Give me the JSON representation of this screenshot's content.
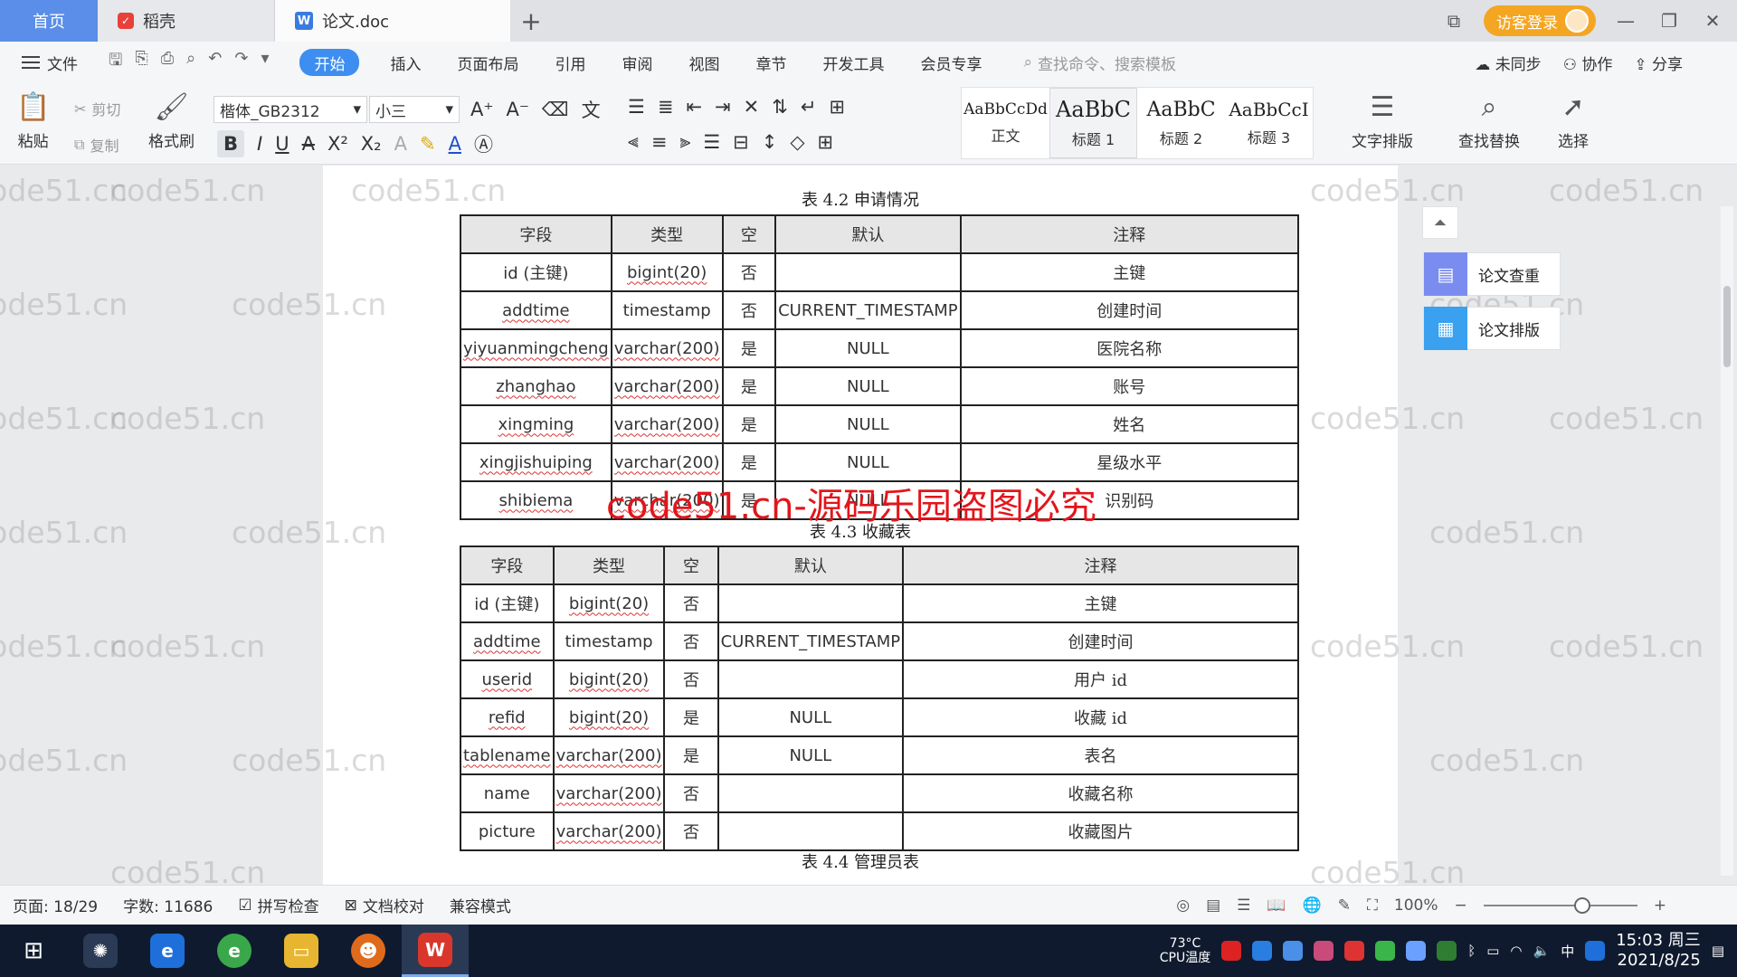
{
  "tabs": {
    "home": "首页",
    "daoke": "稻壳",
    "doc": "论文.doc",
    "add": "+",
    "visitor_login": "访客登录"
  },
  "menu": {
    "file": "文件",
    "items": [
      "开始",
      "插入",
      "页面布局",
      "引用",
      "审阅",
      "视图",
      "章节",
      "开发工具",
      "会员专享"
    ],
    "active_index": 0,
    "search_placeholder": "查找命令、搜索模板",
    "right": [
      "未同步",
      "协作",
      "分享"
    ]
  },
  "ribbon": {
    "paste": "粘贴",
    "cut": "剪切",
    "copy": "复制",
    "format_painter": "格式刷",
    "font_name": "楷体_GB2312",
    "font_size": "小三",
    "styles": [
      {
        "sample": "AaBbCcDd",
        "caption": "正文"
      },
      {
        "sample": "AaBbC",
        "caption": "标题 1"
      },
      {
        "sample": "AaBbC",
        "caption": "标题 2"
      },
      {
        "sample": "AaBbCcI",
        "caption": "标题 3"
      }
    ],
    "text_layout": "文字排版",
    "find_replace": "查找替换",
    "select": "选择"
  },
  "document": {
    "top_caption": "表 4.2  申请情况",
    "table1": {
      "headers": [
        "字段",
        "类型",
        "空",
        "默认",
        "注释"
      ],
      "rows": [
        [
          "id (主键)",
          "bigint(20)",
          "否",
          "",
          "主键"
        ],
        [
          "addtime",
          "timestamp",
          "否",
          "CURRENT_TIMESTAMP",
          "创建时间"
        ],
        [
          "yiyuanmingcheng",
          "varchar(200)",
          "是",
          "NULL",
          "医院名称"
        ],
        [
          "zhanghao",
          "varchar(200)",
          "是",
          "NULL",
          "账号"
        ],
        [
          "xingming",
          "varchar(200)",
          "是",
          "NULL",
          "姓名"
        ],
        [
          "xingjishuiping",
          "varchar(200)",
          "是",
          "NULL",
          "星级水平"
        ],
        [
          "shibiema",
          "varchar(200)",
          "是",
          "NULL",
          "识别码"
        ]
      ]
    },
    "caption2": "表 4.3  收藏表",
    "table2": {
      "headers": [
        "字段",
        "类型",
        "空",
        "默认",
        "注释"
      ],
      "rows": [
        [
          "id (主键)",
          "bigint(20)",
          "否",
          "",
          "主键"
        ],
        [
          "addtime",
          "timestamp",
          "否",
          "CURRENT_TIMESTAMP",
          "创建时间"
        ],
        [
          "userid",
          "bigint(20)",
          "否",
          "",
          "用户 id"
        ],
        [
          "refid",
          "bigint(20)",
          "是",
          "NULL",
          "收藏 id"
        ],
        [
          "tablename",
          "varchar(200)",
          "是",
          "NULL",
          "表名"
        ],
        [
          "name",
          "varchar(200)",
          "否",
          "",
          "收藏名称"
        ],
        [
          "picture",
          "varchar(200)",
          "否",
          "",
          "收藏图片"
        ]
      ]
    },
    "caption3": "表 4.4  管理员表",
    "watermark": "code51.cn",
    "red_stamp": "code51.cn-源码乐园盗图必究"
  },
  "side_panel": {
    "check": "论文查重",
    "layout": "论文排版"
  },
  "status": {
    "page": "页面: 18/29",
    "words": "字数: 11686",
    "spell": "拼写检查",
    "proof": "文档校对",
    "compat": "兼容模式",
    "zoom": "100%"
  },
  "taskbar": {
    "temp": "73°C",
    "cpu": "CPU温度",
    "time": "15:03 周三",
    "date": "2021/8/25",
    "ime": "中"
  },
  "colors": {
    "accent": "#3d8ef0",
    "home_tab": "#5a8ee8",
    "visitor": "#f4a623",
    "stamp_red": "#e3151b"
  }
}
